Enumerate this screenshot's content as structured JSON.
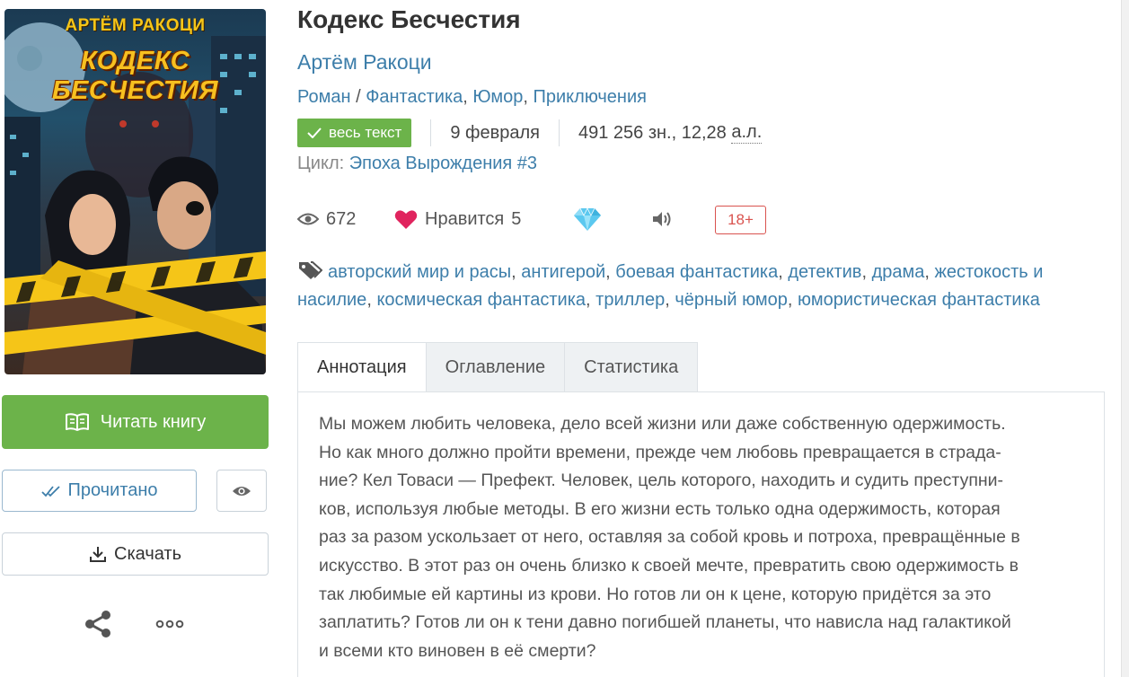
{
  "cover": {
    "author": "АРТЁМ РАКОЦИ",
    "title": "КОДЕКС БЕСЧЕСТИЯ"
  },
  "actions": {
    "read_label": "Читать книгу",
    "read_done_label": "Прочитано",
    "download_label": "Скачать"
  },
  "book": {
    "title": "Кодекс Бесчестия",
    "author": "Артём Ракоци",
    "form": "Роман",
    "genres": [
      "Фантастика",
      "Юмор",
      "Приключения"
    ],
    "status_badge": "весь текст",
    "date": "9 февраля",
    "size_chars": "491 256 зн., 12,28",
    "size_unit": "а.л.",
    "cycle_label": "Цикл:",
    "cycle_name": "Эпоха Вырождения #3"
  },
  "stats": {
    "views": "672",
    "likes_label": "Нравится",
    "likes": "5",
    "age_rating": "18+"
  },
  "tags": [
    "авторский мир и расы",
    "антигерой",
    "боевая фантастика",
    "детектив",
    "драма",
    "жестокость и насилие",
    "космическая фантастика",
    "триллер",
    "чёрный юмор",
    "юмористическая фантастика"
  ],
  "tabs": [
    "Аннотация",
    "Оглавление",
    "Статистика"
  ],
  "annotation_lines": [
    "Мы можем любить человека, дело всей жизни или даже собственную одержимость.",
    "Но как много должно пройти времени, прежде чем любовь превращается в страда-",
    "ние? Кел Товаси — Префект. Человек, цель которого, находить и судить преступни-",
    "ков, используя любые методы. В его жизни есть только одна одержимость, которая",
    "раз за разом ускользает от него, оставляя за собой кровь и потроха, превращённые в",
    "искусство. В этот раз он очень близко к своей мечте, превратить свою одержимость в",
    "так любимые ей картины из крови. Но готов ли он к цене, которую придётся за это",
    "заплатить? Готов ли он к тени давно погибшей планеты, что нависла над галактикой",
    "и всеми кто виновен в её смерти?"
  ],
  "colors": {
    "accent_green": "#6cb34a",
    "link_blue": "#3d7eaa",
    "heart_red": "#e0245e",
    "age_red": "#d9534f",
    "diamond_cyan": "#5bc8ef"
  }
}
